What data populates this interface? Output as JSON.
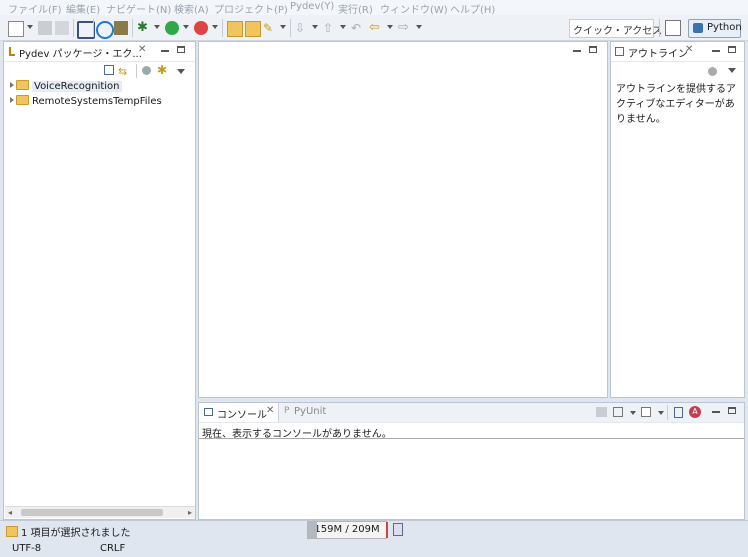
{
  "menu": [
    "ファイル(F)",
    "編集(E)",
    "ナビゲート(N)",
    "検索(A)",
    "プロジェクト(P)",
    "Pydev(Y)",
    "実行(R)",
    "ウィンドウ(W)",
    "ヘルプ(H)"
  ],
  "toolbar": {
    "quick_access": "クイック・アクセス",
    "perspective": "Python"
  },
  "package_explorer": {
    "title": "Pydev パッケージ・エク...",
    "items": [
      {
        "label": "VoiceRecognition",
        "selected": true
      },
      {
        "label": "RemoteSystemsTempFiles",
        "selected": false
      }
    ]
  },
  "outline": {
    "title": "アウトライン",
    "message": "アウトラインを提供するアクティブなエディターがありません。"
  },
  "console": {
    "tab_console": "コンソール",
    "tab_pyunit": "PyUnit",
    "message": "現在、表示するコンソールがありません。"
  },
  "status": {
    "message": "1 項目が選択されました",
    "heap": "159M / 209M",
    "encoding": "UTF-8",
    "line_ending": "CRLF"
  },
  "colors": {
    "accent": "#1f7ad6",
    "selection": "#e5ecf7"
  }
}
